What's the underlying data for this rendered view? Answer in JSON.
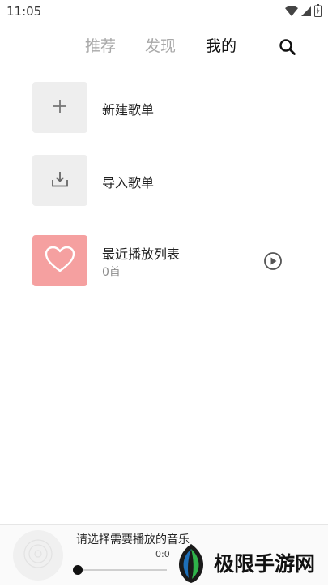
{
  "status_bar": {
    "time": "11:05",
    "icons": [
      "wifi-icon",
      "cell-signal-icon",
      "battery-icon"
    ]
  },
  "tabs": [
    {
      "label": "推荐",
      "active": false
    },
    {
      "label": "发现",
      "active": false
    },
    {
      "label": "我的",
      "active": true
    }
  ],
  "search": {
    "icon": "search-icon"
  },
  "playlists": {
    "new": {
      "title": "新建歌单",
      "icon": "plus-icon"
    },
    "import": {
      "title": "导入歌单",
      "icon": "import-download-icon"
    },
    "recent": {
      "title": "最近播放列表",
      "count": "0首",
      "icon": "heart-icon",
      "action_icon": "play-circle-icon"
    }
  },
  "player": {
    "title": "请选择需要播放的音乐",
    "time": "0:0",
    "progress": 0,
    "disc_icon": "disc-icon"
  },
  "watermark": {
    "text": "极限手游网",
    "logo_icon": "leaf-logo-icon"
  },
  "colors": {
    "active_tab": "#111111",
    "inactive_tab": "#a8a8a8",
    "recent_cover": "#f5a0a0",
    "tile_bg": "#eeeeee"
  }
}
